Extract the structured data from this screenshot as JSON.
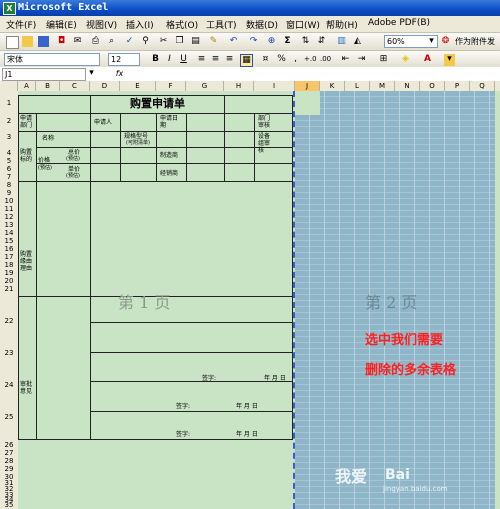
{
  "window": {
    "title": "Microsoft Excel",
    "app_icon": "excel-icon"
  },
  "menus": [
    "文件(F)",
    "编辑(E)",
    "视图(V)",
    "插入(I)",
    "格式(O)",
    "工具(T)",
    "数据(D)",
    "窗口(W)",
    "帮助(H)",
    "Adobe PDF(B)"
  ],
  "toolbar": {
    "zoom": "60%",
    "sigma": "Σ",
    "attach_label": "作为附件发",
    "font_name": "宋体",
    "font_size": "12",
    "bold": "B",
    "italic": "I",
    "underline": "U",
    "comma_style": ",",
    "percent_style": "%",
    "increase_decimal": "+.0",
    "decrease_decimal": ".00"
  },
  "formula_bar": {
    "name_box": "J1",
    "fx": "fx",
    "value": ""
  },
  "columns_page1": [
    "A",
    "B",
    "C",
    "D",
    "E",
    "F",
    "G",
    "H",
    "I"
  ],
  "columns_page2": [
    "J",
    "K",
    "L",
    "M",
    "N",
    "O",
    "P",
    "Q"
  ],
  "rows": [
    "1",
    "2",
    "3",
    "4",
    "5",
    "6",
    "7",
    "8",
    "9",
    "10",
    "11",
    "12",
    "13",
    "14",
    "15",
    "16",
    "17",
    "18",
    "19",
    "20",
    "21",
    "22",
    "23",
    "24",
    "25",
    "26",
    "27",
    "28",
    "29",
    "30",
    "31",
    "32",
    "33",
    "34",
    "35",
    "36"
  ],
  "form": {
    "title": "购置申请单",
    "apply_dept": "申请部门",
    "applicant": "申请人",
    "apply_date": "申请日期",
    "dept_review": "部门审核",
    "name": "名称",
    "spec": "规格型号",
    "spec_note": "(可附清单)",
    "review2": "设备组审核",
    "purchase_target": "购置标的",
    "price": "价格",
    "price_note": "(预估)",
    "total_price": "总价",
    "total_note": "(预估)",
    "unit_price": "单价",
    "unit_note": "(预估)",
    "manufacturer": "制造商",
    "vendor": "经销商",
    "reason": "购置缘由理由",
    "approval": "审批意见",
    "sign": "签字:",
    "date": "年  月  日"
  },
  "watermarks": {
    "page1": "第 1 页",
    "page2": "第 2 页"
  },
  "annotation": {
    "line1": "选中我们需要",
    "line2": "删除的多余表格"
  },
  "site_watermark": {
    "text1": "我爱",
    "text2": "Bai",
    "text3": "jingyan.baidu.com"
  }
}
